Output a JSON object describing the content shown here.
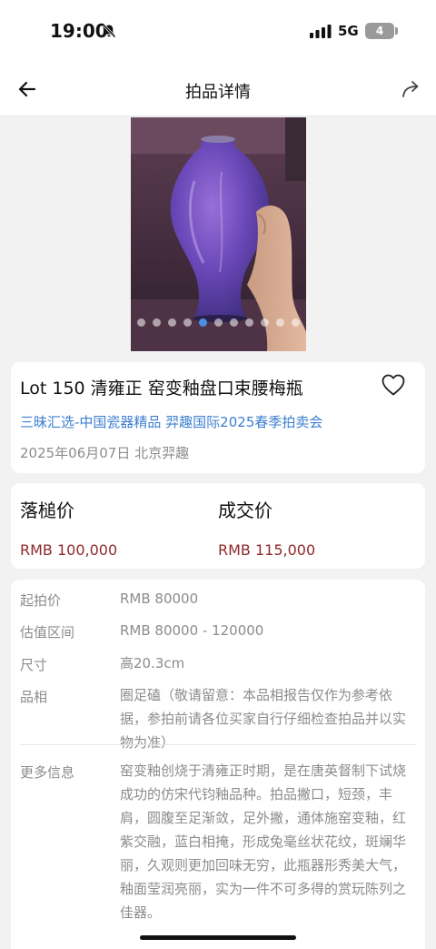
{
  "status_bar": {
    "time": "19:00",
    "network": "5G",
    "battery": "4"
  },
  "nav": {
    "title": "拍品详情",
    "back_icon": "arrow-left-icon",
    "share_icon": "share-icon"
  },
  "gallery": {
    "image_count": 11,
    "active_index": 4,
    "active_color": "#4a90e2"
  },
  "lot": {
    "title": "Lot 150 清雍正 窑变釉盘口束腰梅瓶",
    "sale": "三昧汇选-中国瓷器精品 羿趣国际2025春季拍卖会",
    "date_place": "2025年06月07日 北京羿趣"
  },
  "prices": {
    "hammer_label": "落槌价",
    "hammer_value": "RMB 100,000",
    "deal_label": "成交价",
    "deal_value": "RMB 115,000",
    "value_color": "#8e2a2a"
  },
  "details": [
    {
      "label": "起拍价",
      "value": "RMB 80000"
    },
    {
      "label": "估值区间",
      "value": "RMB 80000 - 120000"
    },
    {
      "label": "尺寸",
      "value": "高20.3cm"
    },
    {
      "label": "品相",
      "value": "圈足磕（敬请留意：本品相报告仅作为参考依据，参拍前请各位买家自行仔细检查拍品并以实物为准）"
    },
    {
      "label": "更多信息",
      "value": "窑变釉创烧于清雍正时期，是在唐英督制下试烧成功的仿宋代钧釉品种。拍品撇口，短颈，丰肩，圆腹至足渐敛，足外撇，通体施窑变釉，红紫交融，蓝白相掩，形成兔毫丝状花纹，斑斓华丽，久观则更加回味无穷，此瓶器形秀美大气，釉面莹润亮丽，实为一件不可多得的赏玩陈列之佳器。"
    }
  ]
}
